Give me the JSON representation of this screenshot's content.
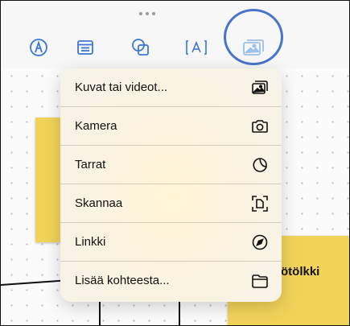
{
  "menu": {
    "items": [
      {
        "label": "Kuvat tai videot...",
        "icon": "photo-library-icon"
      },
      {
        "label": "Kamera",
        "icon": "camera-icon"
      },
      {
        "label": "Tarrat",
        "icon": "sticker-icon"
      },
      {
        "label": "Skannaa",
        "icon": "scan-document-icon"
      },
      {
        "label": "Linkki",
        "icon": "compass-link-icon"
      },
      {
        "label": "Lisää kohteesta...",
        "icon": "folder-icon"
      }
    ]
  },
  "canvas": {
    "sticky_right_text": "ötölkki"
  },
  "toolbar": {
    "tools": [
      "pen-tool-icon",
      "sticky-note-icon",
      "shapes-icon",
      "text-box-icon",
      "media-icon"
    ]
  },
  "colors": {
    "accent": "#4a74c9",
    "sticky": "#f1d35a",
    "toolbar_icon": "#3b76d6"
  }
}
